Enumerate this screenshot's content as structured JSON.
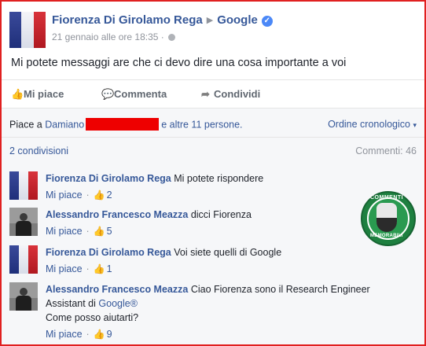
{
  "post": {
    "author": "Fiorenza Di Girolamo Rega",
    "target": "Google",
    "timestamp": "21 gennaio alle ore 18:35",
    "separator": "·",
    "text": "Mi potete messaggi are che ci devo dire una cosa importante a voi"
  },
  "actions": {
    "like": "Mi piace",
    "comment": "Commenta",
    "share": "Condividi"
  },
  "reactions": {
    "prefix": "Piace a",
    "first_name": "Damiano",
    "suffix": "e altre 11 persone.",
    "order": "Ordine cronologico"
  },
  "stats": {
    "shares": "2 condivisioni",
    "comments": "Commenti: 46"
  },
  "comments": [
    {
      "author": "Fiorenza Di Girolamo Rega",
      "text": "Mi potete rispondere",
      "like_label": "Mi piace",
      "likes": "2"
    },
    {
      "author": "Alessandro Francesco Meazza",
      "text": "dicci Fiorenza",
      "like_label": "Mi piace",
      "likes": "5"
    },
    {
      "author": "Fiorenza Di Girolamo Rega",
      "text": "Voi siete quelli di Google",
      "like_label": "Mi piace",
      "likes": "1"
    },
    {
      "author": "Alessandro Francesco Meazza",
      "text_part1": "Ciao Fiorenza sono il Research Engineer Assistant di",
      "link": "Google®",
      "text_part2": "Come posso aiutarti?",
      "like_label": "Mi piace",
      "likes": "9"
    }
  ],
  "badge": {
    "top": "COMMENTI",
    "bottom": "MEMORABILI"
  },
  "colors": {
    "link": "#365899",
    "verified": "#4b88f7",
    "frame": "#e02020",
    "badge": "#1e8040"
  }
}
